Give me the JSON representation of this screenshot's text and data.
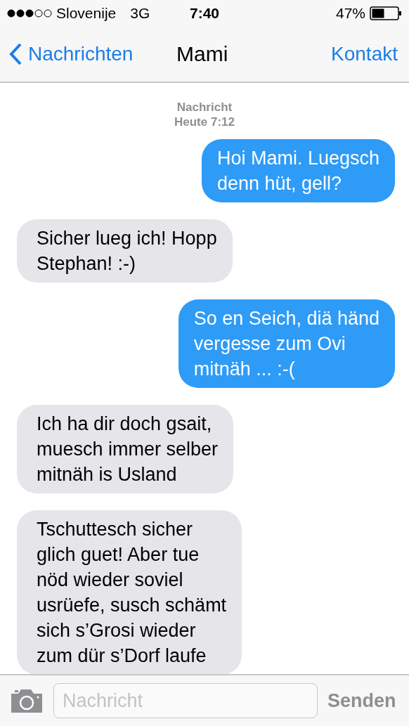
{
  "status_bar": {
    "carrier": "Slovenije",
    "network": "3G",
    "time": "7:40",
    "battery": "47%"
  },
  "nav": {
    "back": "Nachrichten",
    "title": "Mami",
    "action": "Kontakt"
  },
  "timestamp": {
    "label": "Nachricht",
    "time": "Heute 7:12"
  },
  "messages": [
    {
      "kind": "sent",
      "text": "Hoi Mami. Luegsch\ndenn hüt, gell?"
    },
    {
      "kind": "received",
      "text": "Sicher lueg ich! Hopp\nStephan! :-)"
    },
    {
      "kind": "sent",
      "text": "So en Seich, diä händ\nvergesse zum Ovi\nmitnäh ... :-("
    },
    {
      "kind": "received",
      "text": "Ich ha dir doch gsait,\nmuesch immer selber\nmitnäh is Usland"
    },
    {
      "kind": "received",
      "text": "Tschuttesch sicher\nglich guet! Aber tue\nnöd wieder soviel\nusrüefe, susch schämt\nsich s’Grosi wieder\nzum dür s’Dorf laufe"
    }
  ],
  "composer": {
    "placeholder": "Nachricht",
    "send": "Senden"
  }
}
